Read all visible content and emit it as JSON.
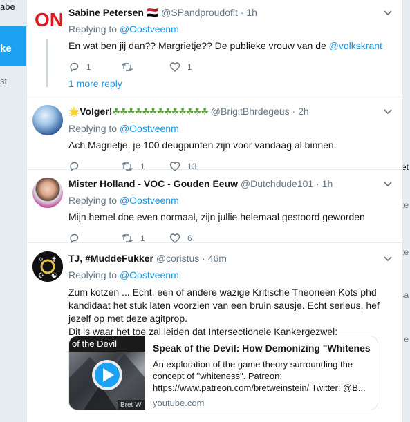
{
  "background": {
    "left_fragments": [
      "abe",
      "ke",
      "st"
    ],
    "right_fragments": [
      "et",
      "ze",
      "ze",
      "sa",
      "e"
    ]
  },
  "tweets": [
    {
      "name": "Sabine Petersen",
      "name_emoji": "🇾🇪",
      "handle": "@SPandproudofit",
      "time": "1h",
      "replying_label": "Replying to",
      "replying_to": "@Oostveenm",
      "text_before": "En wat ben jij dan?? Margrietje?? De publieke vrouw van de ",
      "text_link": "@volkskrant",
      "reply_count": "1",
      "retweet_count": "",
      "like_count": "1",
      "more_replies": "1 more reply"
    },
    {
      "name": "Volger!",
      "name_prefix": "🌟",
      "name_emoji": "☘☘☘☘☘☘☘☘☘☘☘☘☘",
      "handle": "@BrigitBhrdegeus",
      "time": "2h",
      "replying_label": "Replying to",
      "replying_to": "@Oostveenm",
      "text": "Ach Magrietje, je 100 deugpunten zijn voor vandaag al binnen.",
      "reply_count": "",
      "retweet_count": "1",
      "like_count": "13"
    },
    {
      "name": "Mister Holland - VOC - Gouden Eeuw",
      "handle": "@Dutchdude101",
      "time": "1h",
      "replying_label": "Replying to",
      "replying_to": "@Oostveenm",
      "text": "Mijn hemel doe even normaal, zijn jullie helemaal gestoord geworden",
      "reply_count": "",
      "retweet_count": "1",
      "like_count": "6"
    },
    {
      "name": "TJ, #MuddeFukker",
      "handle": "@coristus",
      "time": "46m",
      "replying_label": "Replying to",
      "replying_to": "@Oostveenm",
      "text": "Zum kotzen ... Echt, een of andere wazige Kritische Theorieen Kots phd kandidaat het stuk laten voorzien van een bruin sausje. Echt serieus, hef jezelf op met deze agitprop.",
      "text2": "Dit is waar het toe zal leiden dat Intersectionele Kankergezwel:",
      "card": {
        "thumb_caption": "of the Devil",
        "thumb_caption2": "Bret W",
        "title": "Speak of the Devil: How Demonizing \"Whitenes...",
        "description": "An exploration of the game theory surrounding the concept of \"whiteness\". Patreon: https://www.patreon.com/bretweinstein/ Twitter: @B...",
        "domain": "youtube.com"
      }
    }
  ],
  "colors": {
    "link": "#1b95e0",
    "muted": "#657786",
    "border": "#e6ecf0",
    "play": "#1da1f2"
  }
}
